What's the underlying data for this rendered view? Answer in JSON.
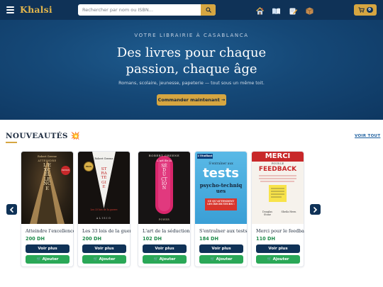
{
  "header": {
    "brand": "Khalsi",
    "search_placeholder": "Rechercher par nom ou ISBN...",
    "cart_count": "0",
    "nav_icons": [
      "home-icon",
      "book-icon",
      "edit-icon",
      "box-icon"
    ]
  },
  "hero": {
    "kicker": "VOTRE LIBRAIRIE À CASABLANCA",
    "title_line1": "Des livres pour chaque",
    "title_line2": "passion, chaque âge",
    "subtitle": "Romans, scolaire, jeunesse, papeterie — tout sous un même toit.",
    "cta": "Commander maintenant →"
  },
  "section": {
    "title": "NOUVEAUTÉS 💥",
    "view_all": "VOIR TOUT"
  },
  "books": [
    {
      "title": "Atteindre l'excellence",
      "price": "200 DH",
      "more_label": "Voir plus",
      "add_label": "Ajouter",
      "cover": {
        "author": "Robert Greene",
        "main": "L'EXCELLENCE",
        "kicker": "ATTEINDRE",
        "badge": "EDITION"
      }
    },
    {
      "title": "Les 33 lois de la guerre",
      "price": "200 DH",
      "more_label": "Voir plus",
      "add_label": "Ajouter",
      "cover": {
        "author": "Robert Greene",
        "main": "STRATÉGIE",
        "sub": "Les 33 lois de la guerre",
        "badge": "PRIX",
        "bottom": "ALISIO"
      }
    },
    {
      "title": "L'art de la séduction",
      "price": "102 DH",
      "more_label": "Voir plus",
      "add_label": "Ajouter",
      "cover": {
        "author": "ROBERT GREENE",
        "kicker": "L'art de la",
        "main": "SÉDUCTION",
        "bottom": "POWER"
      }
    },
    {
      "title": "S'entraîner aux tests",
      "price": "184 DH",
      "more_label": "Voir plus",
      "add_label": "Ajouter",
      "cover": {
        "brand": "L'Etudiant",
        "kicker": "S'entraîner aux",
        "main": "tests",
        "sub": "psycho-techniques",
        "banner": "CE QU'ATTENDENT LES RECRUTEURS !"
      }
    },
    {
      "title": "Merci pour le feedback",
      "price": "110 DH",
      "more_label": "Voir plus",
      "add_label": "Ajouter",
      "cover": {
        "main": "MERCI",
        "kicker": "POUR LE",
        "sub": "FEEDBACK",
        "authors": "Douglas Stone",
        "authors2": "Sheila Heen"
      }
    }
  ],
  "colors": {
    "header_bg": "#0f3257",
    "accent_gold": "#d6a641",
    "button_navy": "#0f3257",
    "button_green": "#2aa857",
    "price_green": "#1d8a4a"
  }
}
